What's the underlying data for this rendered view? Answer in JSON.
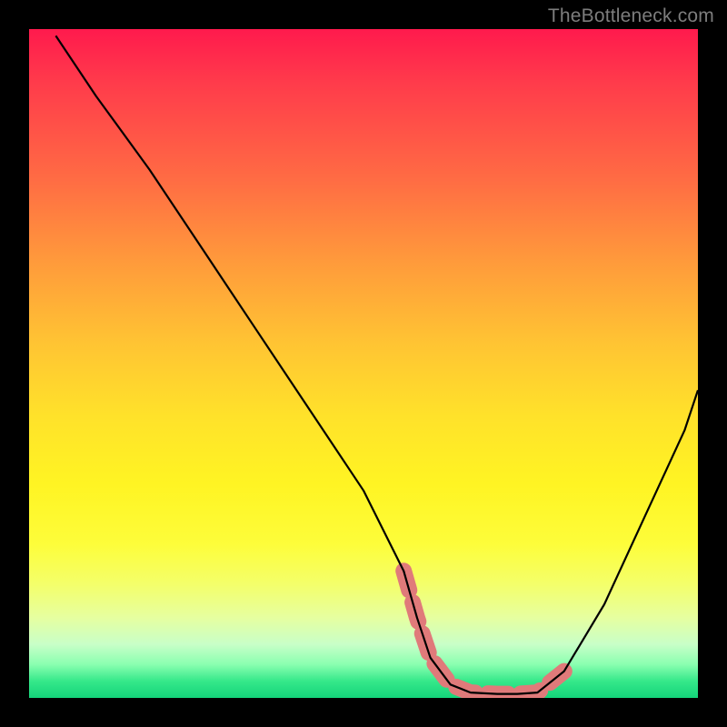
{
  "watermark": {
    "text": "TheBottleneck.com"
  },
  "chart_data": {
    "type": "line",
    "title": "",
    "xlabel": "",
    "ylabel": "",
    "xlim": [
      0,
      100
    ],
    "ylim": [
      0,
      100
    ],
    "grid": false,
    "series": [
      {
        "name": "bottleneck-curve",
        "x": [
          4,
          10,
          18,
          26,
          34,
          42,
          50,
          56,
          58,
          60,
          63,
          66,
          70,
          73,
          76,
          80,
          86,
          92,
          98,
          100
        ],
        "y": [
          99,
          90,
          79,
          67,
          55,
          43,
          31,
          19,
          12,
          6,
          2,
          0.8,
          0.6,
          0.6,
          0.8,
          4,
          14,
          27,
          40,
          46
        ]
      }
    ],
    "highlight": {
      "name": "optimal-region",
      "color": "#e07a7a",
      "x": [
        56,
        58,
        60,
        63,
        66,
        70,
        73,
        76,
        80
      ],
      "y": [
        19,
        12,
        6,
        2,
        0.8,
        0.6,
        0.6,
        0.8,
        4
      ]
    }
  }
}
